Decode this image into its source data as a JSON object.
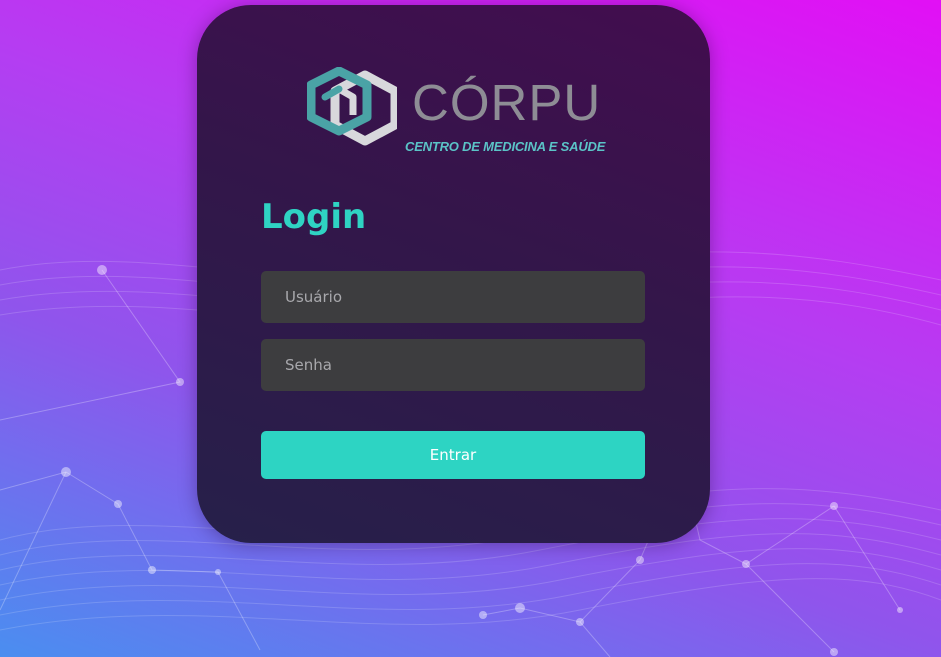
{
  "brand": {
    "name": "CÓRPU",
    "tagline": "CENTRO DE MEDICINA E SAÚDE"
  },
  "login": {
    "title": "Login",
    "username_placeholder": "Usuário",
    "username_value": "",
    "password_placeholder": "Senha",
    "password_value": "",
    "submit_label": "Entrar"
  },
  "colors": {
    "accent": "#2dd4c3",
    "title": "#2fd3c3",
    "input_bg": "#3d3d3f",
    "card_top": "#430d4f",
    "card_bottom": "#26204a",
    "logo_teal": "#4aa3a6",
    "logo_white": "#d8d8dc",
    "brand_gray": "#8e8d95",
    "bg_gradient": [
      "#4a8ef0",
      "#8f55ec",
      "#b63cf2",
      "#e20ff5"
    ]
  },
  "icons": {
    "logo": "hexagon-cube-logo-icon"
  }
}
